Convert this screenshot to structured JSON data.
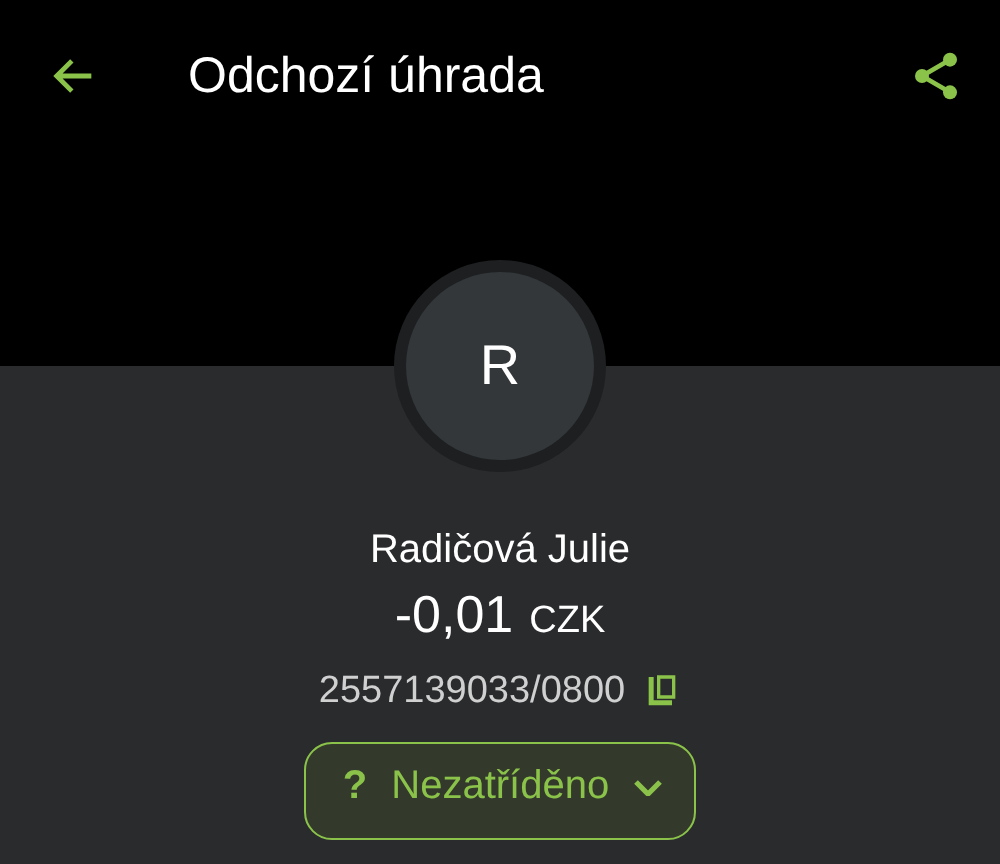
{
  "header": {
    "title": "Odchozí úhrada"
  },
  "avatar": {
    "initial": "R"
  },
  "payee": {
    "name": "Radičová Julie"
  },
  "amount": {
    "value": "-0,01",
    "currency": "CZK"
  },
  "account": {
    "number": "2557139033/0800"
  },
  "category": {
    "icon": "?",
    "label": "Nezatříděno"
  }
}
